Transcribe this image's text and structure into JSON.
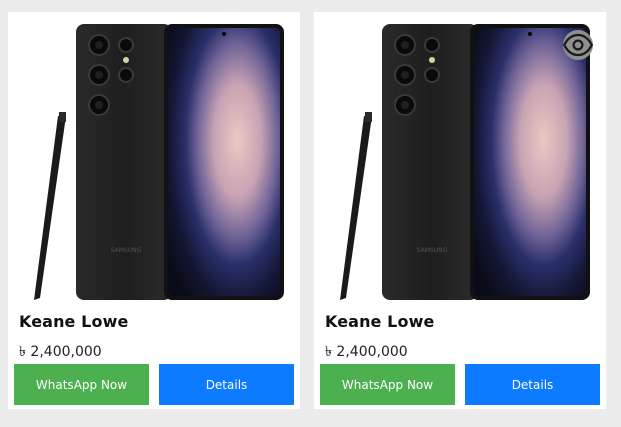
{
  "products": [
    {
      "name": "Keane Lowe",
      "price": "৳ 2,400,000",
      "whatsapp_label": "WhatsApp Now",
      "details_label": "Details",
      "image_icon": "samsung-galaxy-s23-ultra-image",
      "show_quick_view": false
    },
    {
      "name": "Keane Lowe",
      "price": "৳ 2,400,000",
      "whatsapp_label": "WhatsApp Now",
      "details_label": "Details",
      "image_icon": "samsung-galaxy-s23-ultra-image",
      "show_quick_view": true,
      "quick_view_icon": "eye-icon"
    }
  ],
  "colors": {
    "whatsapp": "#4caf50",
    "details": "#0d7bff",
    "page_bg": "#ececec",
    "card_bg": "#ffffff"
  }
}
